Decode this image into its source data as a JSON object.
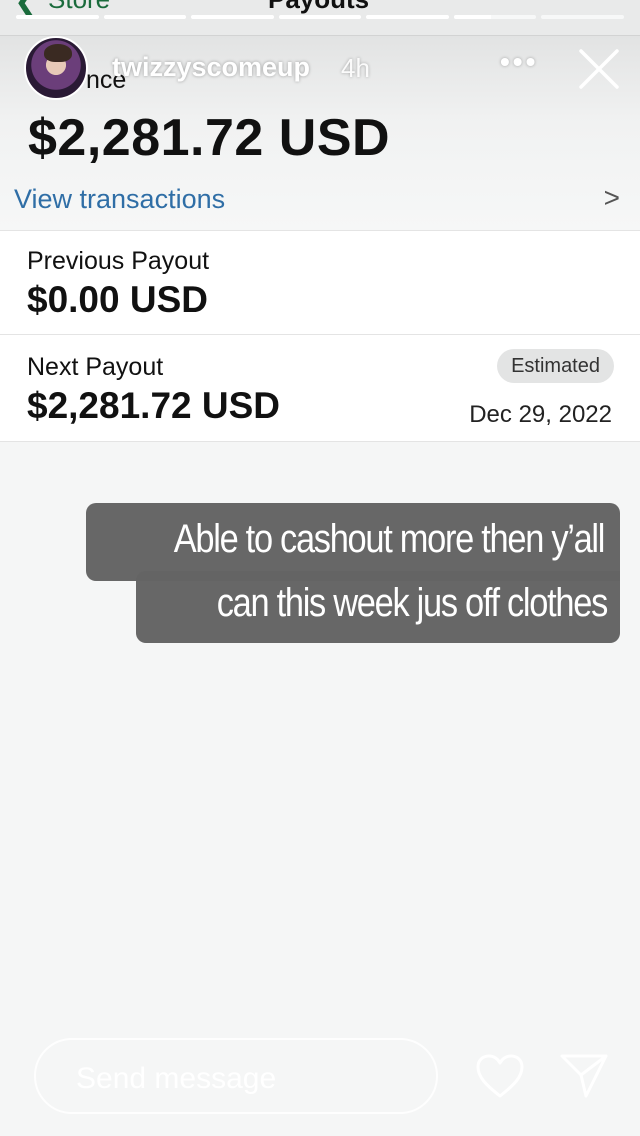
{
  "background_nav": {
    "back_label": "Store",
    "title": "Payouts"
  },
  "story": {
    "progress": [
      1,
      1,
      1,
      1,
      1,
      0.45,
      0
    ],
    "username": "twizzyscomeup",
    "time": "4h",
    "more_icon": "more-horizontal-icon",
    "close_icon": "close-icon"
  },
  "payouts": {
    "balance_label": "nce",
    "balance_amount": "$2,281.72 USD",
    "view_transactions": "View transactions",
    "previous_label": "Previous Payout",
    "previous_amount": "$0.00 USD",
    "next_label": "Next Payout",
    "next_amount": "$2,281.72 USD",
    "next_badge": "Estimated",
    "next_date": "Dec 29, 2022"
  },
  "caption": {
    "line1": "Able to cashout more then y’all",
    "line2": "can this week jus off clothes"
  },
  "reply_bar": {
    "placeholder": "Send message",
    "like_icon": "heart-icon",
    "send_icon": "send-icon"
  }
}
